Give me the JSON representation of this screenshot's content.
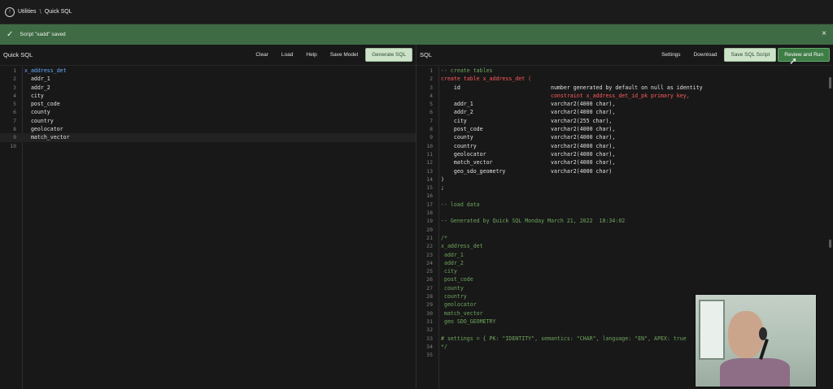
{
  "topbar": {
    "crumbs": [
      "Utilities",
      "Quick SQL"
    ]
  },
  "banner": {
    "message": "Script \"xadd\" saved"
  },
  "left": {
    "title": "Quick SQL",
    "buttons": [
      "Clear",
      "Load",
      "Help",
      "Save Model",
      "Generate SQL"
    ],
    "lines": [
      "x_address_det",
      "  addr_1",
      "  addr_2",
      "  city",
      "  post_code",
      "  county",
      "  country",
      "  geolocator",
      "  match_vector",
      ""
    ]
  },
  "right": {
    "title": "SQL",
    "buttons": [
      "Settings",
      "Download",
      "Save SQL Script",
      "Review and Run"
    ],
    "lines": [
      "-- create tables",
      "create table x_address_det (",
      "    id                            number generated by default on null as identity",
      "                                  constraint x_address_det_id_pk primary key,",
      "    addr_1                        varchar2(4000 char),",
      "    addr_2                        varchar2(4000 char),",
      "    city                          varchar2(255 char),",
      "    post_code                     varchar2(4000 char),",
      "    county                        varchar2(4000 char),",
      "    country                       varchar2(4000 char),",
      "    geolocator                    varchar2(4000 char),",
      "    match_vector                  varchar2(4000 char),",
      "    geo_sdo_geometry              varchar2(4000 char)",
      ")",
      ";",
      "",
      "-- load data",
      "",
      "-- Generated by Quick SQL Monday March 21, 2022  18:34:02",
      "",
      "/*",
      "x_address_det",
      " addr_1",
      " addr_2",
      " city",
      " post_code",
      " county",
      " country",
      " geolocator",
      " match_vector",
      " geo SDO_GEOMETRY",
      "",
      "# settings = { PK: \"IDENTITY\", semantics: \"CHAR\", language: \"EN\", APEX: true",
      "*/",
      ""
    ]
  },
  "colors": {
    "banner": "#3e6b43",
    "primary_button": "#cde3c9",
    "run_button": "#3f7d46",
    "keyword": "#ff5b5b",
    "comment": "#6fa55d"
  }
}
